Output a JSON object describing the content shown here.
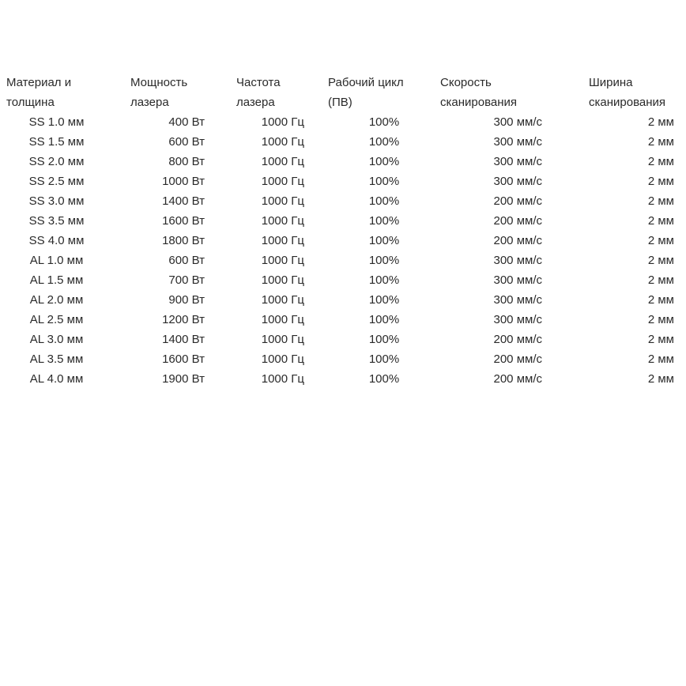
{
  "table": {
    "headers": {
      "material": [
        "Материал и",
        "толщина"
      ],
      "power": [
        "Мощность",
        "лазера"
      ],
      "frequency": [
        "Частота",
        "лазера"
      ],
      "duty_cycle": [
        "Рабочий цикл",
        "(ПВ)"
      ],
      "speed": [
        "Скорость",
        "сканирования"
      ],
      "width": [
        "Ширина",
        "сканирования"
      ]
    },
    "rows": [
      {
        "material": "SS 1.0 мм",
        "power": "400 Вт",
        "frequency": "1000 Гц",
        "duty_cycle": "100%",
        "speed": "300 мм/с",
        "width": "2 мм"
      },
      {
        "material": "SS 1.5 мм",
        "power": "600 Вт",
        "frequency": "1000 Гц",
        "duty_cycle": "100%",
        "speed": "300 мм/с",
        "width": "2 мм"
      },
      {
        "material": "SS 2.0 мм",
        "power": "800 Вт",
        "frequency": "1000 Гц",
        "duty_cycle": "100%",
        "speed": "300 мм/с",
        "width": "2 мм"
      },
      {
        "material": "SS 2.5 мм",
        "power": "1000 Вт",
        "frequency": "1000 Гц",
        "duty_cycle": "100%",
        "speed": "300 мм/с",
        "width": "2 мм"
      },
      {
        "material": "SS 3.0 мм",
        "power": "1400 Вт",
        "frequency": "1000 Гц",
        "duty_cycle": "100%",
        "speed": "200 мм/с",
        "width": "2 мм"
      },
      {
        "material": "SS 3.5 мм",
        "power": "1600 Вт",
        "frequency": "1000 Гц",
        "duty_cycle": "100%",
        "speed": "200 мм/с",
        "width": "2 мм"
      },
      {
        "material": "SS 4.0 мм",
        "power": "1800 Вт",
        "frequency": "1000 Гц",
        "duty_cycle": "100%",
        "speed": "200 мм/с",
        "width": "2 мм"
      },
      {
        "material": "AL 1.0 мм",
        "power": "600 Вт",
        "frequency": "1000 Гц",
        "duty_cycle": "100%",
        "speed": "300 мм/с",
        "width": "2 мм"
      },
      {
        "material": "AL 1.5 мм",
        "power": "700 Вт",
        "frequency": "1000 Гц",
        "duty_cycle": "100%",
        "speed": "300 мм/с",
        "width": "2 мм"
      },
      {
        "material": "AL 2.0 мм",
        "power": "900 Вт",
        "frequency": "1000 Гц",
        "duty_cycle": "100%",
        "speed": "300 мм/с",
        "width": "2 мм"
      },
      {
        "material": "AL 2.5 мм",
        "power": "1200 Вт",
        "frequency": "1000 Гц",
        "duty_cycle": "100%",
        "speed": "300 мм/с",
        "width": "2 мм"
      },
      {
        "material": "AL 3.0 мм",
        "power": "1400 Вт",
        "frequency": "1000 Гц",
        "duty_cycle": "100%",
        "speed": "200 мм/с",
        "width": "2 мм"
      },
      {
        "material": "AL 3.5 мм",
        "power": "1600 Вт",
        "frequency": "1000 Гц",
        "duty_cycle": "100%",
        "speed": "200 мм/с",
        "width": "2 мм"
      },
      {
        "material": "AL 4.0 мм",
        "power": "1900 Вт",
        "frequency": "1000 Гц",
        "duty_cycle": "100%",
        "speed": "200 мм/с",
        "width": "2 мм"
      }
    ]
  }
}
